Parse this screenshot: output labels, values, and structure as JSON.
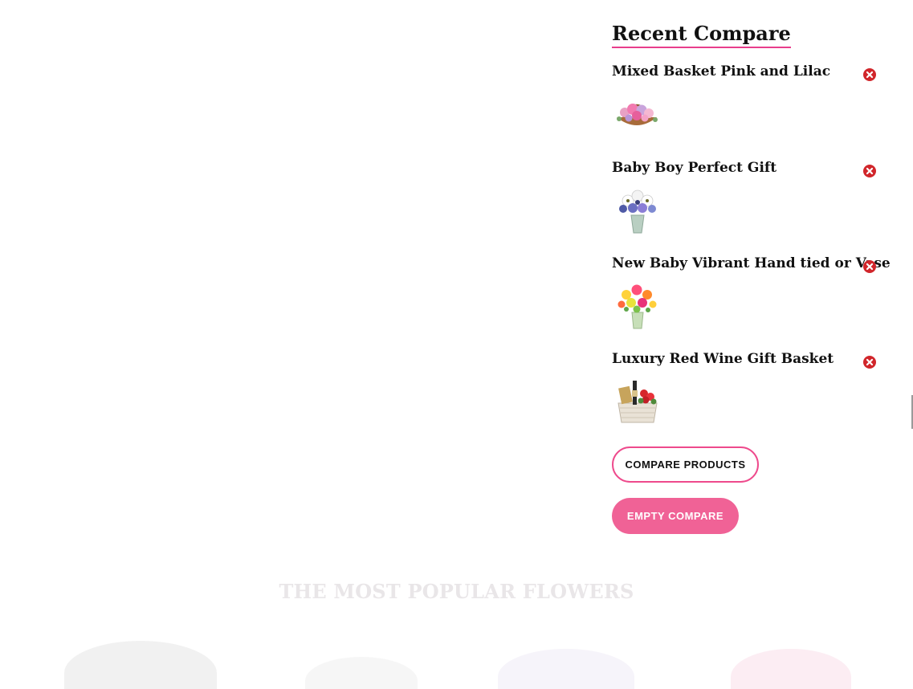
{
  "compare": {
    "title": "Recent Compare",
    "items": [
      {
        "name": "Mixed Basket Pink and Lilac",
        "icon": "pink-lilac-basket-image"
      },
      {
        "name": "Baby Boy Perfect Gift",
        "icon": "blue-white-bouquet-image"
      },
      {
        "name": "New Baby Vibrant Hand tied or Vase",
        "icon": "vibrant-bouquet-image"
      },
      {
        "name": "Luxury Red Wine Gift Basket",
        "icon": "wine-gift-basket-image"
      }
    ],
    "compare_button": "COMPARE PRODUCTS",
    "empty_button": "EMPTY COMPARE",
    "remove_icon": "close-circle-icon"
  },
  "section": {
    "title": "THE MOST POPULAR FLOWERS"
  },
  "colors": {
    "accent": "#ee4a8c",
    "accent_fill": "#f06296",
    "remove": "#d1262b"
  }
}
